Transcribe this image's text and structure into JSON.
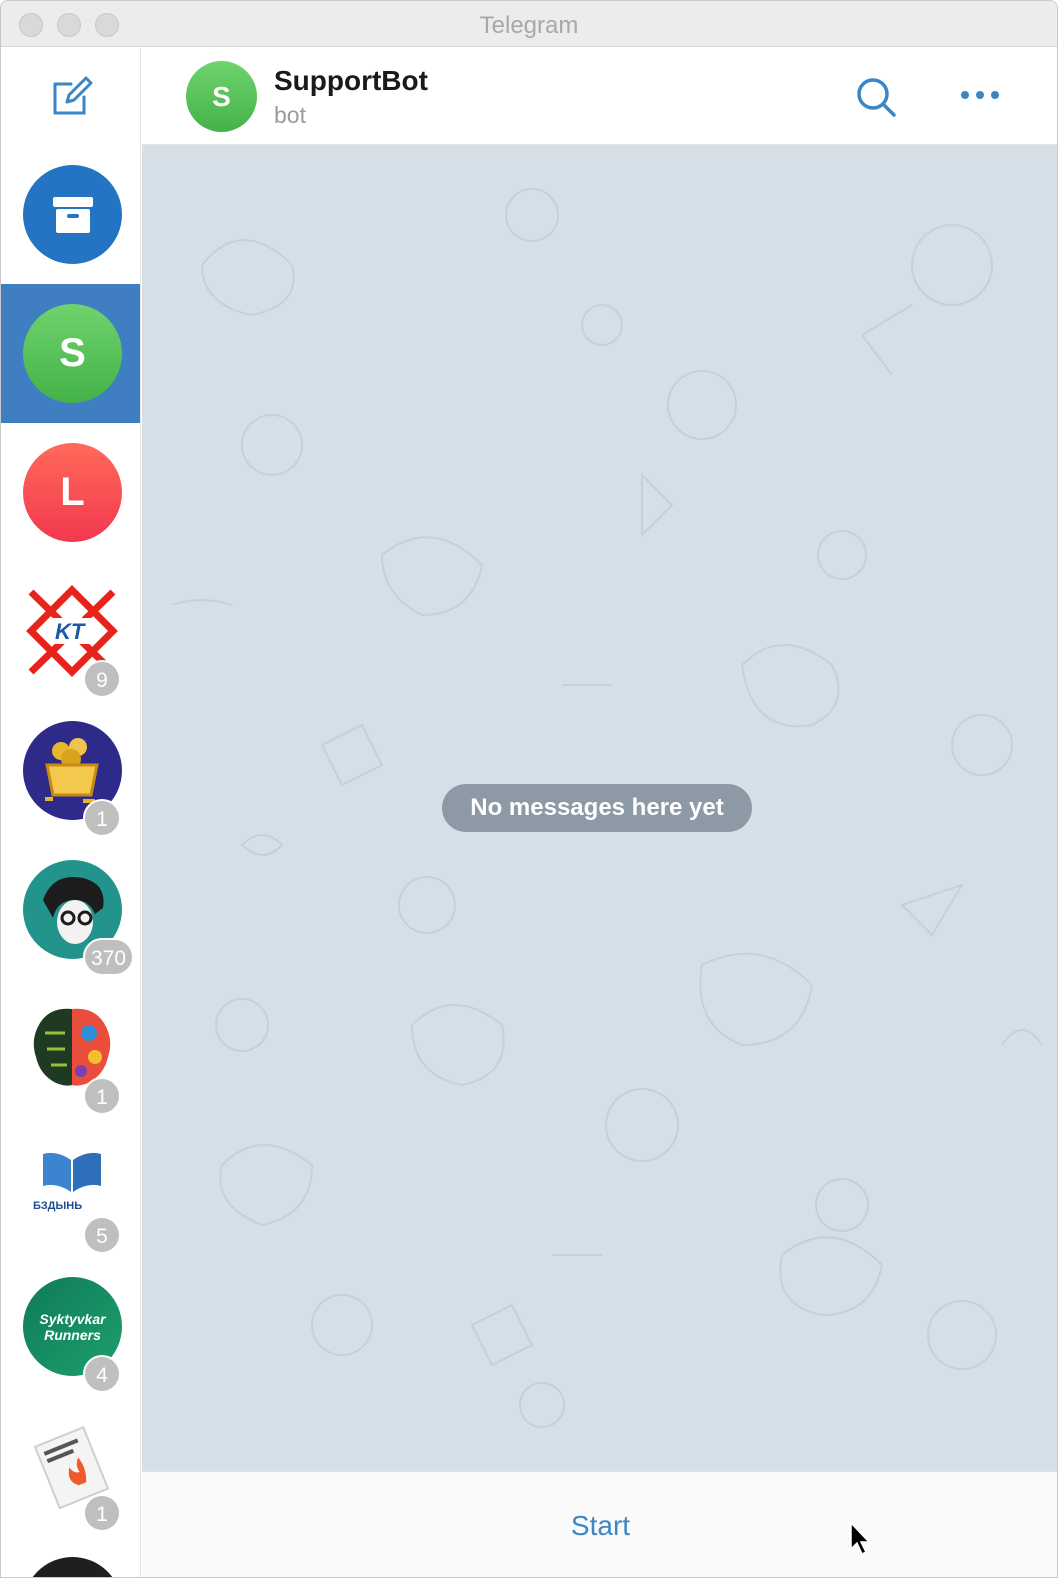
{
  "window": {
    "title": "Telegram"
  },
  "sidebar": {
    "chats": [
      {
        "kind": "archive",
        "badge": ""
      },
      {
        "kind": "letter",
        "initial": "S",
        "badge": "",
        "active": true,
        "color": "#55c157"
      },
      {
        "kind": "letter",
        "initial": "L",
        "badge": "",
        "color": "#f2484f"
      },
      {
        "kind": "image",
        "logo_text": "KT",
        "badge": "9"
      },
      {
        "kind": "image",
        "badge": "1"
      },
      {
        "kind": "image",
        "badge": "370"
      },
      {
        "kind": "image",
        "badge": "1"
      },
      {
        "kind": "image",
        "logo_text": "БЗДЫНЬ",
        "badge": "5"
      },
      {
        "kind": "image",
        "logo_text": "Syktyvkar Runners",
        "badge": "4"
      },
      {
        "kind": "image",
        "badge": "1"
      }
    ]
  },
  "header": {
    "avatar_initial": "S",
    "name": "SupportBot",
    "status": "bot"
  },
  "chat": {
    "empty_text": "No messages here yet"
  },
  "bottom": {
    "start_label": "Start"
  },
  "colors": {
    "accent": "#3b86c6",
    "active_item": "#3f7fc1",
    "chat_bg": "#d5dfe8"
  }
}
